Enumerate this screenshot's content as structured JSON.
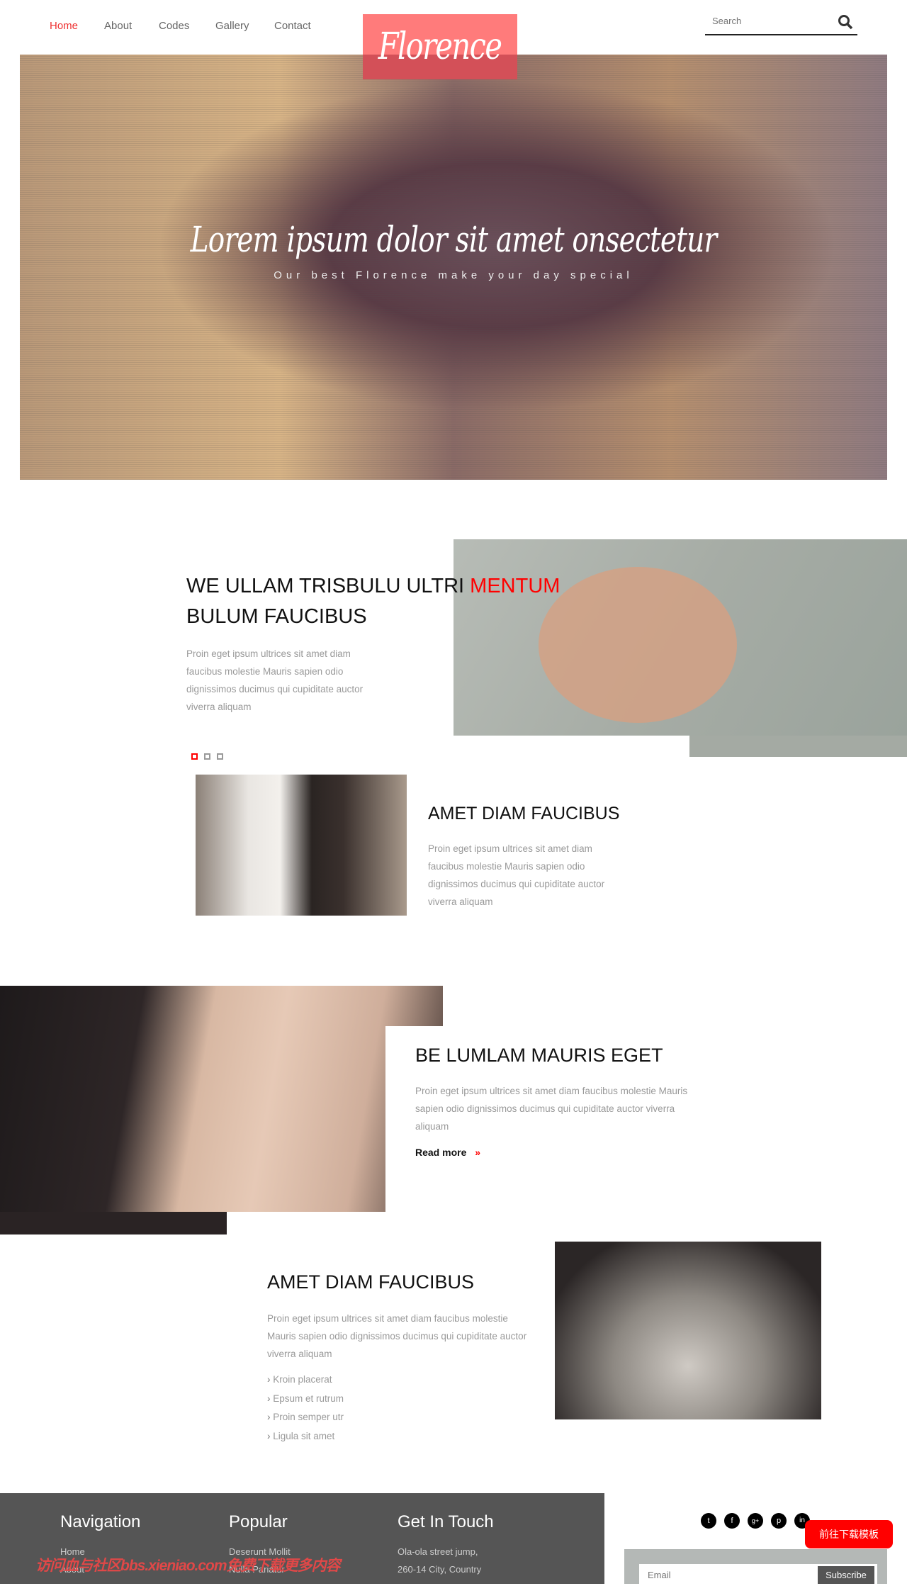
{
  "nav": {
    "items": [
      {
        "label": "Home",
        "active": true
      },
      {
        "label": "About"
      },
      {
        "label": "Codes"
      },
      {
        "label": "Gallery"
      },
      {
        "label": "Contact"
      }
    ]
  },
  "logo": "Florence",
  "search": {
    "placeholder": "Search",
    "icon": "search-icon"
  },
  "hero": {
    "title": "Lorem ipsum dolor sit amet onsectetur",
    "subtitle": "Our best Florence make your day special"
  },
  "section1": {
    "heading_part1": "WE ULLAM TRISBULU ULTRI ",
    "heading_accent": "MENTUM",
    "heading_line2": "BULUM FAUCIBUS",
    "text": "Proin eget ipsum ultrices sit amet diam faucibus molestie Mauris sapien odio dignissimos ducimus qui cupiditate auctor viverra aliquam",
    "active_dot": 1,
    "dot_count": 3
  },
  "section2": {
    "heading": "AMET DIAM FAUCIBUS",
    "text": "Proin eget ipsum ultrices sit amet diam faucibus molestie Mauris sapien odio dignissimos ducimus qui cupiditate auctor viverra aliquam"
  },
  "section3": {
    "heading": "BE LUMLAM MAURIS EGET",
    "text": "Proin eget ipsum ultrices sit amet diam faucibus molestie Mauris sapien odio dignissimos ducimus qui cupiditate auctor viverra aliquam",
    "read_more": "Read more"
  },
  "section4": {
    "heading": "AMET DIAM FAUCIBUS",
    "text": "Proin eget ipsum ultrices sit amet diam faucibus molestie Mauris sapien odio dignissimos ducimus qui cupiditate auctor viverra aliquam",
    "list": [
      "Kroin placerat",
      "Epsum et rutrum",
      "Proin semper utr",
      "Ligula sit amet"
    ]
  },
  "footer": {
    "cols": [
      {
        "title": "Navigation",
        "links": [
          "Home",
          "About"
        ]
      },
      {
        "title": "Popular",
        "links": [
          "Deserunt Mollit",
          "Nulla Pariatur"
        ]
      },
      {
        "title": "Get In Touch",
        "links": [
          "Ola-ola street jump,",
          "260-14 City, Country"
        ]
      }
    ],
    "social": [
      "twitter-icon",
      "facebook-icon",
      "google-plus-icon",
      "pinterest-icon",
      "linkedin-icon"
    ],
    "email_placeholder": "Email",
    "subscribe": "Subscribe"
  },
  "download_button": "前往下载模板",
  "watermark": "访问血与社区bbs.xieniao.com免费下载更多内容",
  "colors": {
    "accent": "#ff0000",
    "logo": "#ff7b7b",
    "footer": "#555555"
  }
}
